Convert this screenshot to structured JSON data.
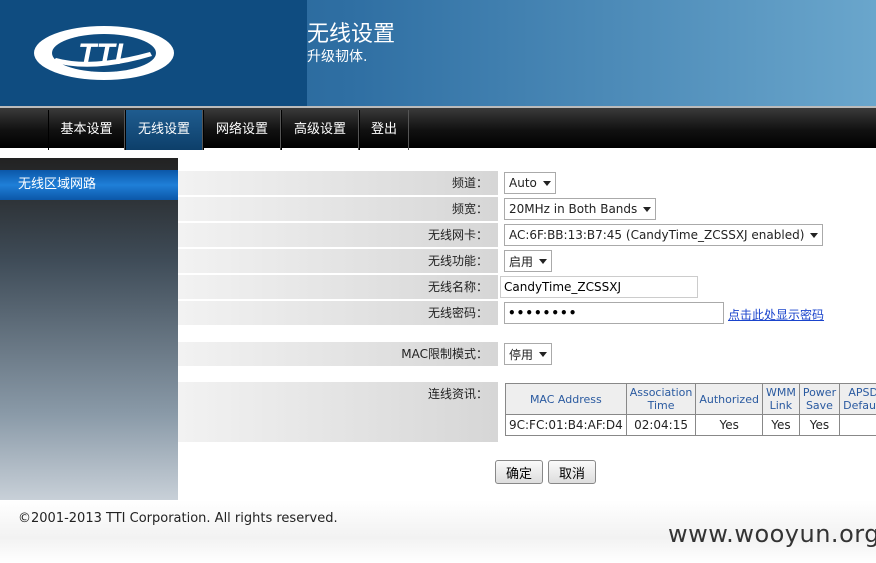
{
  "header": {
    "title": "无线设置",
    "subtitle": "升级韧体.",
    "logo_text": "TTI"
  },
  "nav": [
    "基本设置",
    "无线设置",
    "网络设置",
    "高级设置",
    "登出"
  ],
  "sidebar": {
    "item": "无线区域网路"
  },
  "form": {
    "channel": {
      "label": "频道：",
      "value": "Auto"
    },
    "bandwidth": {
      "label": "频宽：",
      "value": "20MHz in Both Bands"
    },
    "adapter": {
      "label": "无线网卡：",
      "value": "AC:6F:BB:13:B7:45 (CandyTime_ZCSSXJ enabled)"
    },
    "function": {
      "label": "无线功能：",
      "value": "启用"
    },
    "ssid": {
      "label": "无线名称：",
      "value": "CandyTime_ZCSSXJ"
    },
    "password": {
      "label": "无线密码：",
      "value": "••••••••",
      "show_link": "点击此处显示密码"
    },
    "mac_filter": {
      "label": "MAC限制模式：",
      "value": "停用"
    },
    "conn_info": {
      "label": "连线资讯："
    }
  },
  "conn_table": {
    "headers": [
      "MAC Address",
      "Association Time",
      "Authorized",
      "WMM Link",
      "Power Save",
      "APSD Default"
    ],
    "rows": [
      [
        "9C:FC:01:B4:AF:D4",
        "02:04:15",
        "Yes",
        "Yes",
        "Yes",
        ""
      ]
    ]
  },
  "buttons": {
    "ok": "确定",
    "cancel": "取消"
  },
  "footer": {
    "copyright": "©2001-2013 TTI Corporation. All rights reserved.",
    "watermark": "www.wooyun.org"
  },
  "colors": {
    "header_blue": "#0f4c80",
    "active_tab": "#1f5c8f",
    "sidebar_active": "#1f7fd8"
  }
}
